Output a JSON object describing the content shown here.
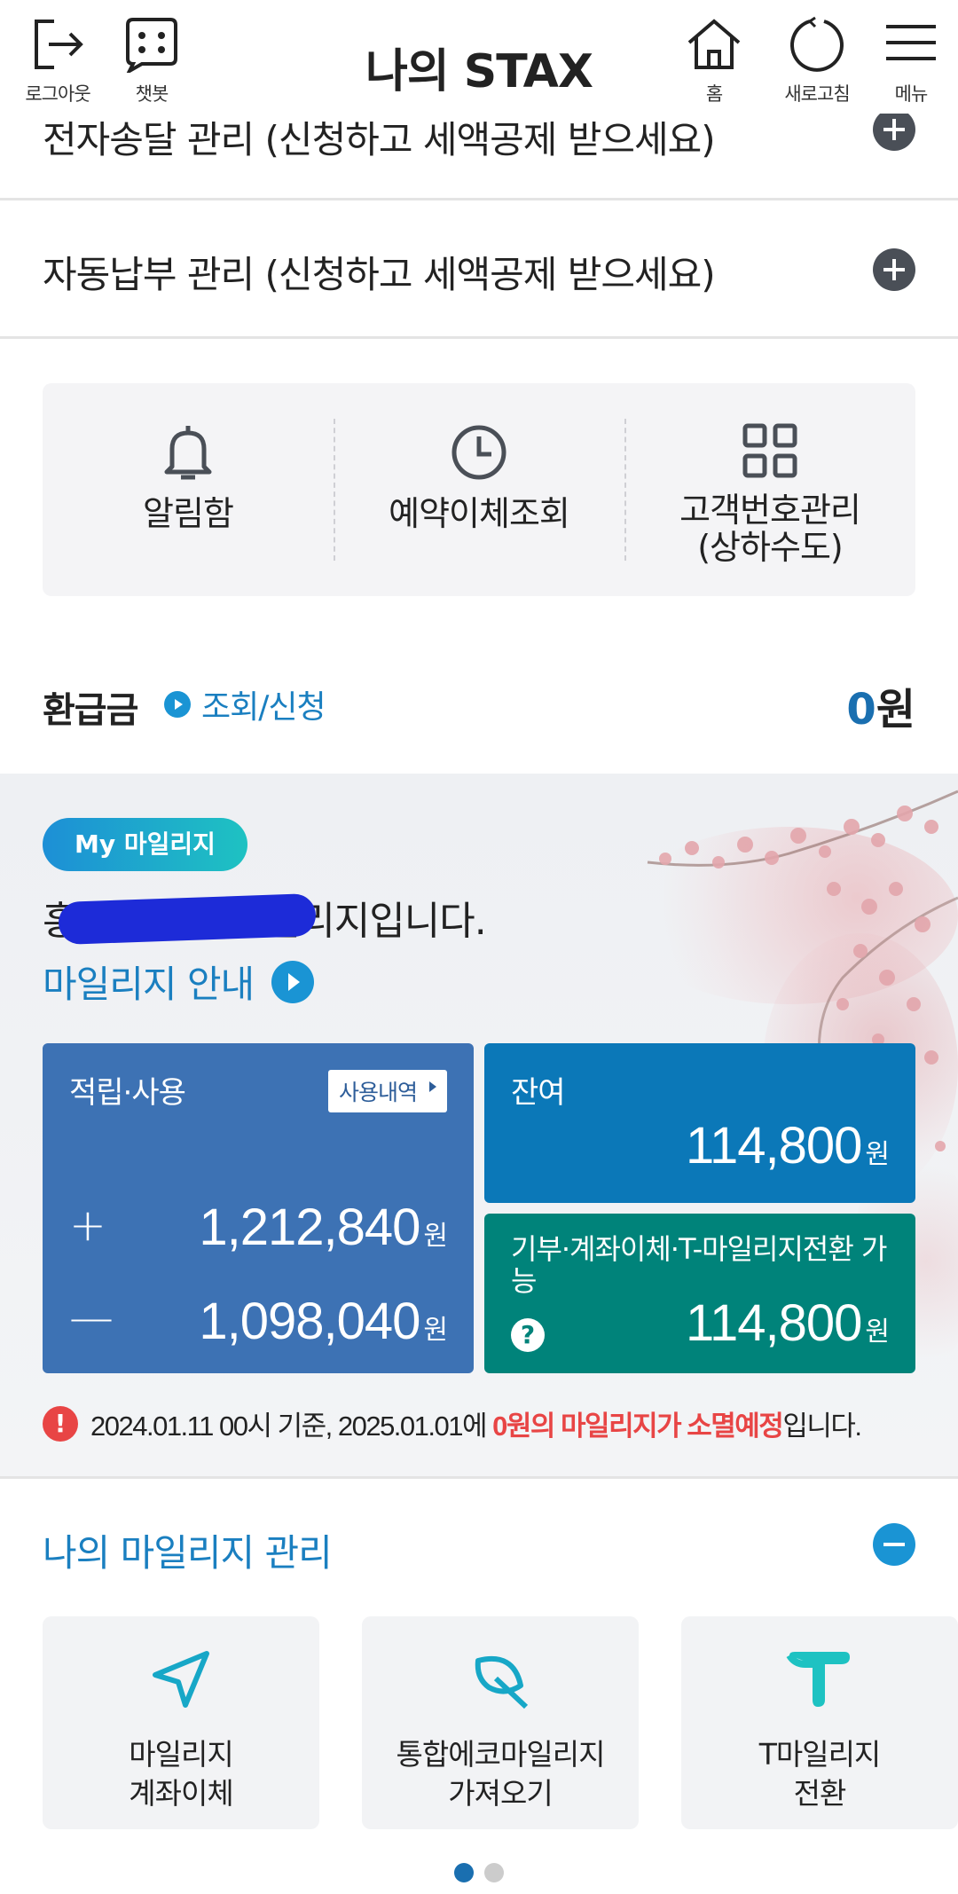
{
  "header": {
    "title": "나의 STAX",
    "logout_label": "로그아웃",
    "chatbot_label": "챗봇",
    "home_label": "홈",
    "refresh_label": "새로고침",
    "menu_label": "메뉴"
  },
  "rows": {
    "partial_label": "전자송달 관리 (신청하고 세액공제 받으세요)",
    "autopay_label": "자동납부 관리 (신청하고 세액공제 받으세요)"
  },
  "quick_menu": [
    {
      "label": "알림함",
      "icon": "bell-icon"
    },
    {
      "label": "예약이체조회",
      "icon": "clock-icon"
    },
    {
      "label": "고객번호관리\n(상하수도)",
      "icon": "grid-icon"
    }
  ],
  "refund": {
    "title": "환급금",
    "link_label": "조회/신청",
    "amount_num": "0",
    "amount_unit": "원"
  },
  "mileage": {
    "badge": "My 마일리지",
    "text": "홍길동님의 마일리지입니다.",
    "guide_label": "마일리지 안내",
    "accumulate_title": "적립·사용",
    "history_label": "사용내역",
    "earned": "1,212,840",
    "used": "1,098,040",
    "balance_title": "잔여",
    "balance": "114,800",
    "donation_title": "기부·계좌이체·T-마일리지전환 가능",
    "donation_amount": "114,800",
    "unit": "원",
    "plus_sign": "+",
    "minus_sign": "—",
    "warning_prefix": "2024.01.11 00시 기준, 2025.01.01에 ",
    "warning_highlight": "0원의 마일리지가 소멸예정",
    "warning_suffix": "입니다."
  },
  "manage": {
    "title": "나의 마일리지 관리",
    "tiles": [
      {
        "line1": "마일리지",
        "line2": "계좌이체",
        "icon": "send-icon"
      },
      {
        "line1": "통합에코마일리지",
        "line2": "가져오기",
        "icon": "leaf-icon"
      },
      {
        "line1": "T마일리지",
        "line2": "전환",
        "icon": "t-logo-icon"
      }
    ]
  },
  "colors": {
    "accent": "#1a7fc0",
    "card_blue": "#3d72b4",
    "card_balance": "#0b78b8",
    "card_green": "#00837a",
    "warning": "#e84545"
  }
}
